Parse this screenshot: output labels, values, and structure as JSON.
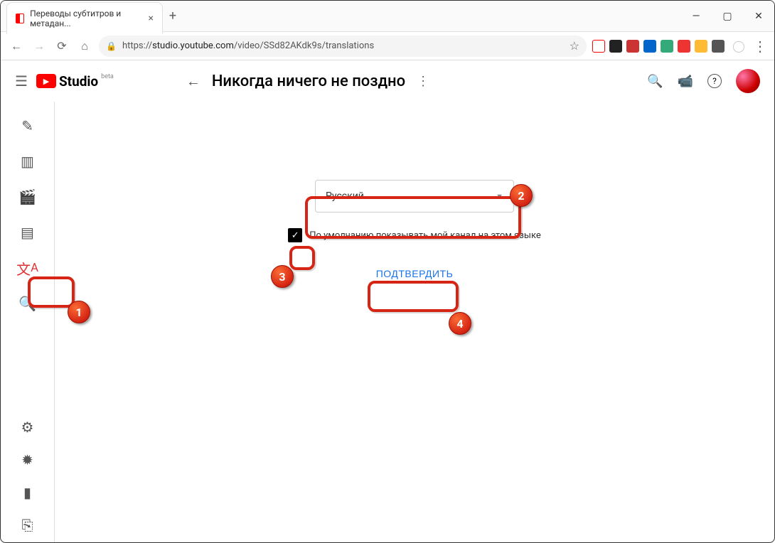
{
  "browser": {
    "tab_title": "Переводы субтитров и метадан...",
    "url_proto": "https://",
    "url_host": "studio.youtube.com",
    "url_path": "/video/SSd82AKdk9s/translations"
  },
  "colors": {
    "accent": "#1a73e8",
    "anno": "#d62514"
  },
  "header": {
    "brand": "Studio",
    "brand_sub": "beta",
    "page_title": "Никогда ничего не поздно"
  },
  "sidebar": {
    "top_items": [
      "edit-icon",
      "analytics-icon",
      "editor-icon",
      "comments-icon",
      "translate-icon",
      "music-icon"
    ],
    "bottom_items": [
      "settings-icon",
      "feedback-icon",
      "updates-icon",
      "exit-icon"
    ]
  },
  "form": {
    "language": "Русский",
    "checkbox_label": "По умолчанию показывать мой канал на этом языке",
    "checkbox_checked": true,
    "confirm_label": "ПОДТВЕРДИТЬ"
  },
  "annotations": {
    "badges": [
      "1",
      "2",
      "3",
      "4"
    ]
  }
}
